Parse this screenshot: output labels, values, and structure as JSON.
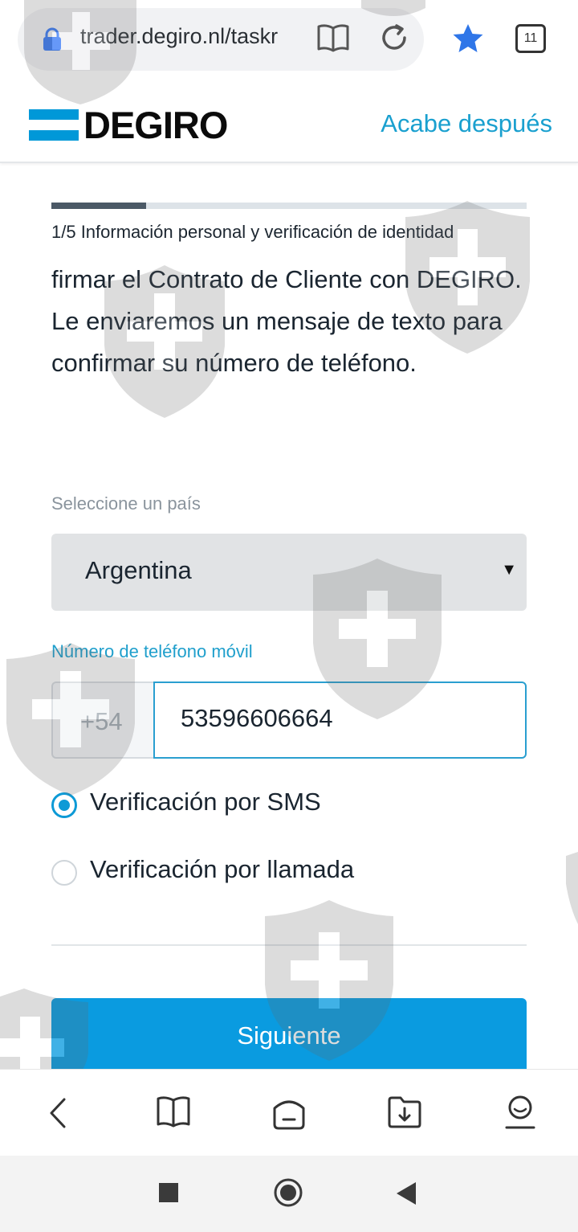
{
  "browser": {
    "url": "trader.degiro.nl/taskr",
    "tab_count": "11"
  },
  "header": {
    "logo": "DEGIRO",
    "finish_later": "Acabe después"
  },
  "progress": {
    "fraction": 0.2,
    "step_label": "1/5 Información personal y verificación de identidad"
  },
  "intro": {
    "text": "firmar el Contrato de Cliente con DEGIRO. Le enviaremos un mensaje de texto para confirmar su número de teléfono."
  },
  "country": {
    "label": "Seleccione un país",
    "value": "Argentina"
  },
  "phone": {
    "label": "Número de teléfono móvil",
    "prefix": "+54",
    "value": "53596606664"
  },
  "verification": {
    "options": [
      {
        "label": "Verificación por SMS",
        "selected": true
      },
      {
        "label": "Verificación por llamada",
        "selected": false
      }
    ]
  },
  "actions": {
    "next": "Siguiente"
  },
  "colors": {
    "brand": "#0098d8",
    "link": "#1aa0cf",
    "button": "#0a9be0"
  },
  "icons": [
    "lock-icon",
    "reader-icon",
    "reload-icon",
    "star-icon",
    "tabs-icon",
    "back-icon",
    "bookmarks-icon",
    "home-icon",
    "downloads-icon",
    "profile-icon",
    "recents-icon",
    "home-circle-icon",
    "nav-back-icon"
  ]
}
